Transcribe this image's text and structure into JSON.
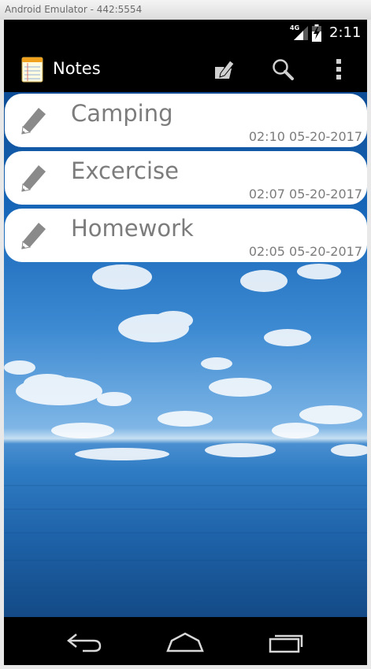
{
  "window": {
    "title": "Android Emulator - 442:5554"
  },
  "status_bar": {
    "network": "4G",
    "time": "2:11"
  },
  "action_bar": {
    "title": "Notes",
    "icons": [
      "notepad-app-icon",
      "new-note-icon",
      "search-icon",
      "overflow-menu-icon"
    ]
  },
  "notes": [
    {
      "title": "Camping",
      "time": "02:10 05-20-2017",
      "icon": "pencil-icon"
    },
    {
      "title": "Excercise",
      "time": "02:07 05-20-2017",
      "icon": "pencil-icon"
    },
    {
      "title": "Homework",
      "time": "02:05 05-20-2017",
      "icon": "pencil-icon"
    }
  ],
  "nav_bar": {
    "icons": [
      "back-icon",
      "home-icon",
      "recent-apps-icon"
    ]
  },
  "colors": {
    "action_bar": "#000000",
    "card": "#ffffff",
    "text_gray": "#7c7c7c",
    "sky": "#1766b8",
    "sea": "#1e62a8"
  }
}
